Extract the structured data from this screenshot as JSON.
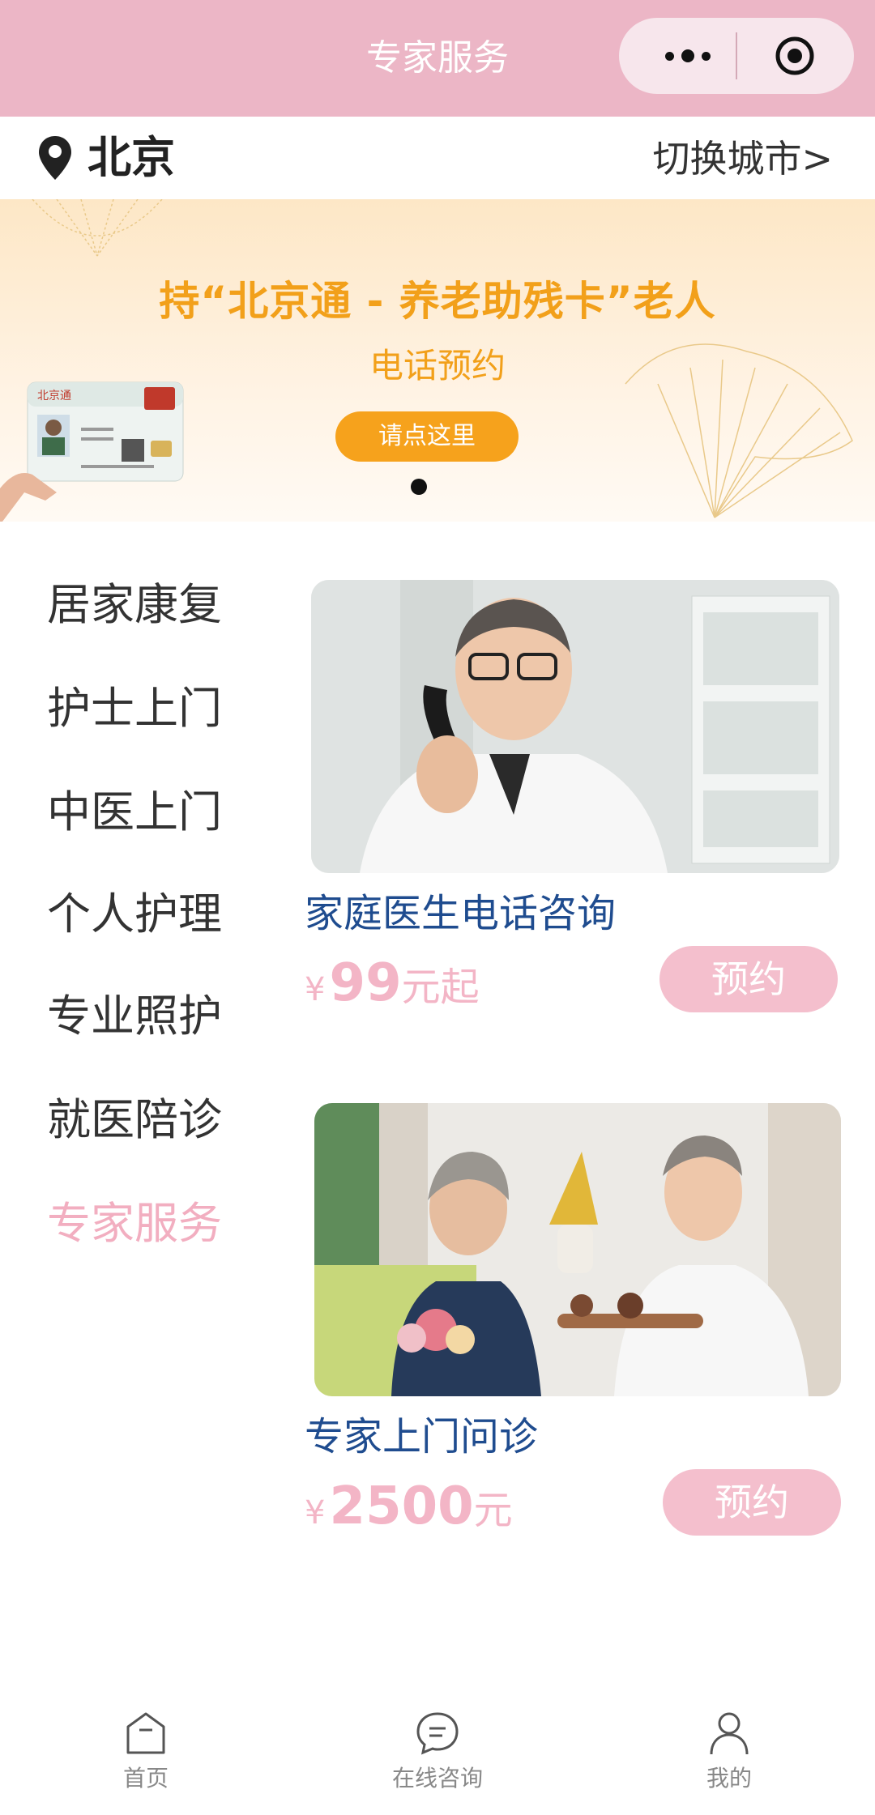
{
  "header": {
    "title": "专家服务"
  },
  "location": {
    "city": "北京",
    "switch_label": "切换城市>"
  },
  "banner": {
    "line1": "持“北京通 - 养老助残卡”老人",
    "line2": "电话预约",
    "button": "请点这里",
    "card_text": "北京通"
  },
  "menu": {
    "items": [
      "居家康复",
      "护士上门",
      "中医上门",
      "个人护理",
      "专业照护",
      "就医陪诊",
      "专家服务"
    ],
    "active": "专家服务"
  },
  "services": [
    {
      "title": "家庭医生电话咨询",
      "currency": "¥",
      "price": "99",
      "unit": "元起",
      "button": "预约"
    },
    {
      "title": "专家上门问诊",
      "currency": "¥",
      "price": "2500",
      "unit": "元",
      "button": "预约"
    }
  ],
  "tabbar": {
    "items": [
      {
        "label": "首页",
        "icon": "home-icon"
      },
      {
        "label": "在线咨询",
        "icon": "chat-icon"
      },
      {
        "label": "我的",
        "icon": "user-icon"
      }
    ]
  },
  "colors": {
    "header_bg": "#ecb6c6",
    "accent_orange": "#f2a01a",
    "accent_pink": "#f4bfcd",
    "title_blue": "#1f4c8f"
  }
}
